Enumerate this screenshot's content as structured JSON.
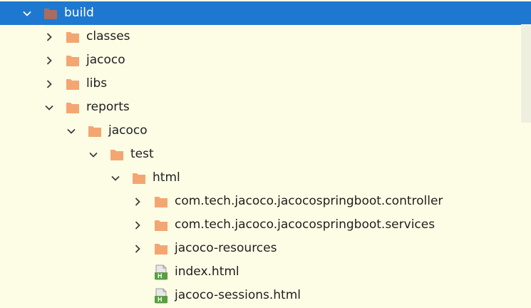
{
  "tree": {
    "items": [
      {
        "label": "build",
        "level": 0,
        "expanded": true,
        "type": "folder",
        "selected": true
      },
      {
        "label": "classes",
        "level": 1,
        "expanded": false,
        "type": "folder"
      },
      {
        "label": "jacoco",
        "level": 1,
        "expanded": false,
        "type": "folder"
      },
      {
        "label": "libs",
        "level": 1,
        "expanded": false,
        "type": "folder"
      },
      {
        "label": "reports",
        "level": 1,
        "expanded": true,
        "type": "folder"
      },
      {
        "label": "jacoco",
        "level": 2,
        "expanded": true,
        "type": "folder"
      },
      {
        "label": "test",
        "level": 3,
        "expanded": true,
        "type": "folder"
      },
      {
        "label": "html",
        "level": 4,
        "expanded": true,
        "type": "folder"
      },
      {
        "label": "com.tech.jacoco.jacocospringboot.controller",
        "level": 5,
        "expanded": false,
        "type": "folder"
      },
      {
        "label": "com.tech.jacoco.jacocospringboot.services",
        "level": 5,
        "expanded": false,
        "type": "folder"
      },
      {
        "label": "jacoco-resources",
        "level": 5,
        "expanded": false,
        "type": "folder"
      },
      {
        "label": "index.html",
        "level": 5,
        "type": "html-file"
      },
      {
        "label": "jacoco-sessions.html",
        "level": 5,
        "type": "html-file"
      }
    ]
  },
  "colors": {
    "background": "#fdfde6",
    "selection": "#1f78cf",
    "folder": "#f4a672",
    "selected_folder": "#a86d61",
    "html_file": "#5b9d43"
  }
}
